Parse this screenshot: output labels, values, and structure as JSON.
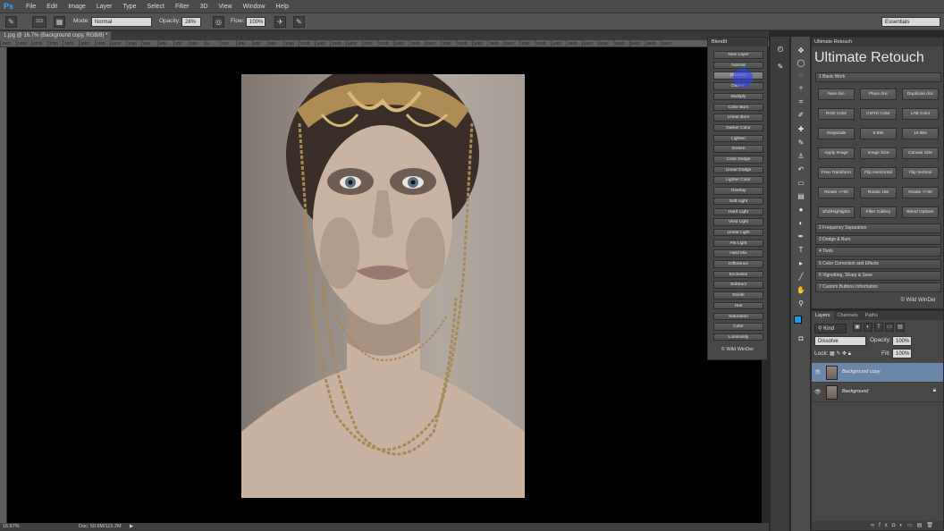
{
  "app": {
    "logo": "Ps"
  },
  "menu": [
    "File",
    "Edit",
    "Image",
    "Layer",
    "Type",
    "Select",
    "Filter",
    "3D",
    "View",
    "Window",
    "Help"
  ],
  "options": {
    "brush_size": "115",
    "mode_label": "Mode:",
    "mode_value": "Normal",
    "opacity_label": "Opacity:",
    "opacity_value": "28%",
    "flow_label": "Flow:",
    "flow_value": "100%",
    "workspace": "Essentials"
  },
  "document": {
    "tab": "1.jpg @ 16.7% (Background copy, RGB/8) *"
  },
  "ruler_ticks": [
    "2600",
    "2400",
    "2200",
    "2000",
    "1800",
    "1600",
    "1400",
    "1200",
    "1000",
    "800",
    "600",
    "400",
    "200",
    "0",
    "200",
    "400",
    "600",
    "800",
    "1000",
    "1200",
    "1400",
    "1600",
    "1800",
    "2000",
    "2200",
    "2400",
    "2600",
    "2800",
    "3000",
    "3200",
    "3400",
    "3600",
    "3800",
    "4000",
    "4200",
    "4400",
    "4600",
    "4800",
    "5000",
    "5200",
    "5400",
    "5600",
    "5800"
  ],
  "status": {
    "zoom": "16.67%",
    "doc": "Doc: 50.6M/115.2M"
  },
  "blendit": {
    "title": "BlendIt",
    "buttons": [
      "New Layer",
      "Normal",
      "Dissolve",
      "Darken",
      "Multiply",
      "Color Burn",
      "Linear Burn",
      "Darker Color",
      "Lighten",
      "Screen",
      "Color Dodge",
      "Linear Dodge",
      "Lighter Color",
      "Overlay",
      "Soft Light",
      "Hard Light",
      "Vivid Light",
      "Linear Light",
      "Pin Light",
      "Hard Mix",
      "Difference",
      "Exclusion",
      "Subtract",
      "Divide",
      "Hue",
      "Saturation",
      "Color",
      "Luminosity"
    ],
    "footer": "© Wild WinDer"
  },
  "ultimate": {
    "header": "Ultimate Retouch",
    "title": "Ultimate Retouch",
    "section1": "1 Basic Work",
    "buttons": [
      "New doc",
      "Place doc",
      "Duplicate doc",
      "RGB Color",
      "CMYK Color",
      "LAB Color",
      "Grayscale",
      "8 Bits",
      "16 Bits",
      "Apply Image",
      "Image Size",
      "Canvas Size",
      "Free Transform",
      "Flip Horizontal",
      "Flip Vertical",
      "Rotate +/-90",
      "Rotate 180",
      "Rotate +/-90",
      "Shd/Highlights",
      "Filter Gallery",
      "Blend Options"
    ],
    "sections": [
      "2 Frequency Separation",
      "3 Dodge & Burn",
      "4 Tools",
      "5 Color Correction and Effects",
      "6 Vignetting, Sharp & Save",
      "7 Custom Buttons  Information"
    ],
    "footer": "© Wild WinDer"
  },
  "layers": {
    "tabs": [
      "Layers",
      "Channels",
      "Paths"
    ],
    "kind": "Kind",
    "blend": "Dissolve",
    "opacity_label": "Opacity:",
    "opacity_value": "100%",
    "lock_label": "Lock:",
    "fill_label": "Fill:",
    "fill_value": "100%",
    "items": [
      {
        "name": "Background copy"
      },
      {
        "name": "Background"
      }
    ]
  }
}
